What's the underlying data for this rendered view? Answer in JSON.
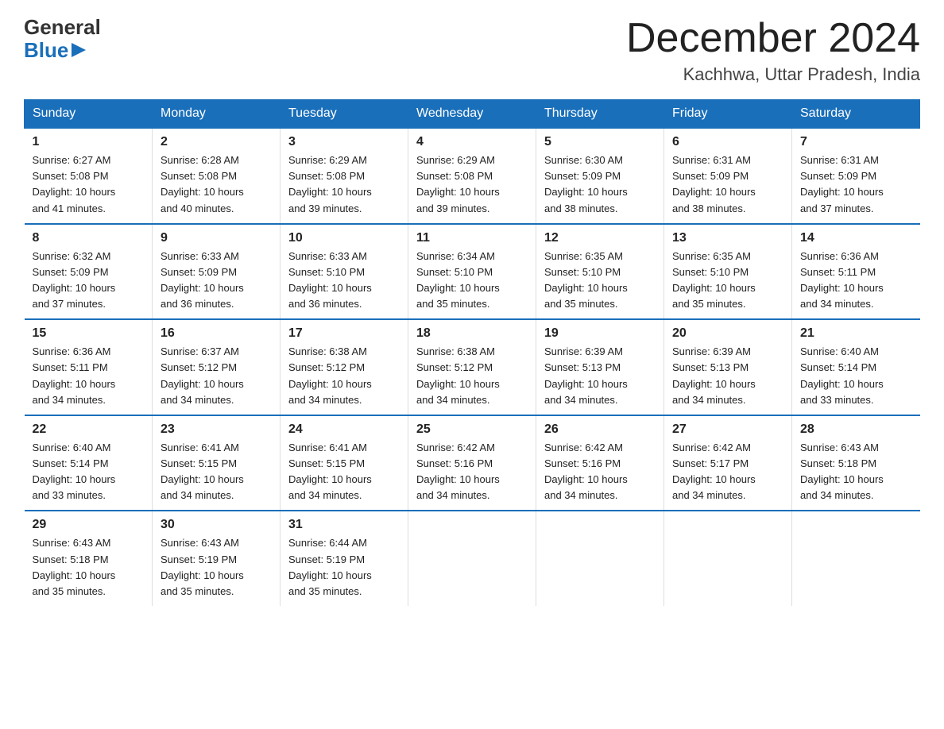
{
  "header": {
    "logo_line1": "General",
    "logo_line2": "Blue",
    "title": "December 2024",
    "subtitle": "Kachhwa, Uttar Pradesh, India"
  },
  "days_of_week": [
    "Sunday",
    "Monday",
    "Tuesday",
    "Wednesday",
    "Thursday",
    "Friday",
    "Saturday"
  ],
  "weeks": [
    [
      {
        "day": "1",
        "sunrise": "6:27 AM",
        "sunset": "5:08 PM",
        "daylight": "10 hours and 41 minutes."
      },
      {
        "day": "2",
        "sunrise": "6:28 AM",
        "sunset": "5:08 PM",
        "daylight": "10 hours and 40 minutes."
      },
      {
        "day": "3",
        "sunrise": "6:29 AM",
        "sunset": "5:08 PM",
        "daylight": "10 hours and 39 minutes."
      },
      {
        "day": "4",
        "sunrise": "6:29 AM",
        "sunset": "5:08 PM",
        "daylight": "10 hours and 39 minutes."
      },
      {
        "day": "5",
        "sunrise": "6:30 AM",
        "sunset": "5:09 PM",
        "daylight": "10 hours and 38 minutes."
      },
      {
        "day": "6",
        "sunrise": "6:31 AM",
        "sunset": "5:09 PM",
        "daylight": "10 hours and 38 minutes."
      },
      {
        "day": "7",
        "sunrise": "6:31 AM",
        "sunset": "5:09 PM",
        "daylight": "10 hours and 37 minutes."
      }
    ],
    [
      {
        "day": "8",
        "sunrise": "6:32 AM",
        "sunset": "5:09 PM",
        "daylight": "10 hours and 37 minutes."
      },
      {
        "day": "9",
        "sunrise": "6:33 AM",
        "sunset": "5:09 PM",
        "daylight": "10 hours and 36 minutes."
      },
      {
        "day": "10",
        "sunrise": "6:33 AM",
        "sunset": "5:10 PM",
        "daylight": "10 hours and 36 minutes."
      },
      {
        "day": "11",
        "sunrise": "6:34 AM",
        "sunset": "5:10 PM",
        "daylight": "10 hours and 35 minutes."
      },
      {
        "day": "12",
        "sunrise": "6:35 AM",
        "sunset": "5:10 PM",
        "daylight": "10 hours and 35 minutes."
      },
      {
        "day": "13",
        "sunrise": "6:35 AM",
        "sunset": "5:10 PM",
        "daylight": "10 hours and 35 minutes."
      },
      {
        "day": "14",
        "sunrise": "6:36 AM",
        "sunset": "5:11 PM",
        "daylight": "10 hours and 34 minutes."
      }
    ],
    [
      {
        "day": "15",
        "sunrise": "6:36 AM",
        "sunset": "5:11 PM",
        "daylight": "10 hours and 34 minutes."
      },
      {
        "day": "16",
        "sunrise": "6:37 AM",
        "sunset": "5:12 PM",
        "daylight": "10 hours and 34 minutes."
      },
      {
        "day": "17",
        "sunrise": "6:38 AM",
        "sunset": "5:12 PM",
        "daylight": "10 hours and 34 minutes."
      },
      {
        "day": "18",
        "sunrise": "6:38 AM",
        "sunset": "5:12 PM",
        "daylight": "10 hours and 34 minutes."
      },
      {
        "day": "19",
        "sunrise": "6:39 AM",
        "sunset": "5:13 PM",
        "daylight": "10 hours and 34 minutes."
      },
      {
        "day": "20",
        "sunrise": "6:39 AM",
        "sunset": "5:13 PM",
        "daylight": "10 hours and 34 minutes."
      },
      {
        "day": "21",
        "sunrise": "6:40 AM",
        "sunset": "5:14 PM",
        "daylight": "10 hours and 33 minutes."
      }
    ],
    [
      {
        "day": "22",
        "sunrise": "6:40 AM",
        "sunset": "5:14 PM",
        "daylight": "10 hours and 33 minutes."
      },
      {
        "day": "23",
        "sunrise": "6:41 AM",
        "sunset": "5:15 PM",
        "daylight": "10 hours and 34 minutes."
      },
      {
        "day": "24",
        "sunrise": "6:41 AM",
        "sunset": "5:15 PM",
        "daylight": "10 hours and 34 minutes."
      },
      {
        "day": "25",
        "sunrise": "6:42 AM",
        "sunset": "5:16 PM",
        "daylight": "10 hours and 34 minutes."
      },
      {
        "day": "26",
        "sunrise": "6:42 AM",
        "sunset": "5:16 PM",
        "daylight": "10 hours and 34 minutes."
      },
      {
        "day": "27",
        "sunrise": "6:42 AM",
        "sunset": "5:17 PM",
        "daylight": "10 hours and 34 minutes."
      },
      {
        "day": "28",
        "sunrise": "6:43 AM",
        "sunset": "5:18 PM",
        "daylight": "10 hours and 34 minutes."
      }
    ],
    [
      {
        "day": "29",
        "sunrise": "6:43 AM",
        "sunset": "5:18 PM",
        "daylight": "10 hours and 35 minutes."
      },
      {
        "day": "30",
        "sunrise": "6:43 AM",
        "sunset": "5:19 PM",
        "daylight": "10 hours and 35 minutes."
      },
      {
        "day": "31",
        "sunrise": "6:44 AM",
        "sunset": "5:19 PM",
        "daylight": "10 hours and 35 minutes."
      },
      null,
      null,
      null,
      null
    ]
  ],
  "labels": {
    "sunrise": "Sunrise:",
    "sunset": "Sunset:",
    "daylight": "Daylight:"
  }
}
